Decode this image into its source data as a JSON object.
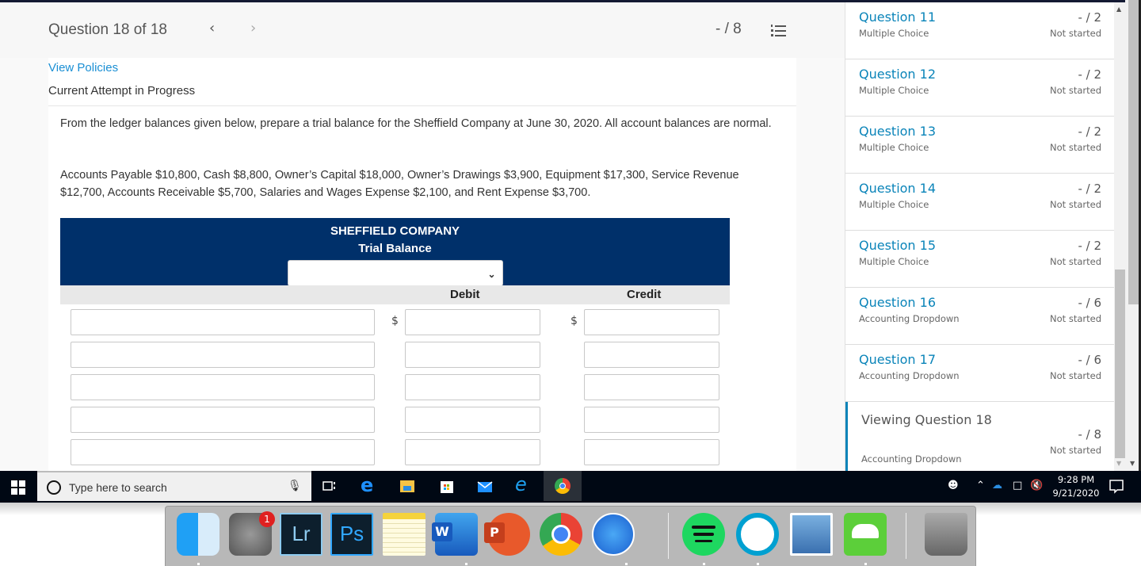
{
  "header": {
    "question_title": "Question 18 of 18",
    "prev_icon": "chevron-left-icon",
    "next_icon": "chevron-right-icon",
    "score": "- / 8",
    "list_icon": "numbered-list-icon"
  },
  "content": {
    "view_policies": "View Policies",
    "attempt_status": "Current Attempt in Progress",
    "instructions": "From the ledger balances given below, prepare a trial balance for the Sheffield Company at June 30, 2020. All account balances are normal.",
    "ledger_balances": "Accounts Payable $10,800, Cash $8,800, Owner’s Capital $18,000, Owner’s Drawings $3,900, Equipment $17,300, Service Revenue $12,700, Accounts Receivable $5,700, Salaries and Wages Expense $2,100, and Rent Expense $3,700."
  },
  "trial_balance": {
    "company": "SHEFFIELD COMPANY",
    "title": "Trial Balance",
    "date_select_value": "",
    "debit_label": "Debit",
    "credit_label": "Credit",
    "currency_symbol": "$",
    "rows": [
      {
        "account": "",
        "debit": "",
        "credit": ""
      },
      {
        "account": "",
        "debit": "",
        "credit": ""
      },
      {
        "account": "",
        "debit": "",
        "credit": ""
      },
      {
        "account": "",
        "debit": "",
        "credit": ""
      },
      {
        "account": "",
        "debit": "",
        "credit": ""
      }
    ]
  },
  "sidebar": {
    "questions": [
      {
        "name": "Question 11",
        "type": "Multiple Choice",
        "points": "- / 2",
        "status": "Not started"
      },
      {
        "name": "Question 12",
        "type": "Multiple Choice",
        "points": "- / 2",
        "status": "Not started"
      },
      {
        "name": "Question 13",
        "type": "Multiple Choice",
        "points": "- / 2",
        "status": "Not started"
      },
      {
        "name": "Question 14",
        "type": "Multiple Choice",
        "points": "- / 2",
        "status": "Not started"
      },
      {
        "name": "Question 15",
        "type": "Multiple Choice",
        "points": "- / 2",
        "status": "Not started"
      },
      {
        "name": "Question 16",
        "type": "Accounting Dropdown",
        "points": "- / 6",
        "status": "Not started"
      },
      {
        "name": "Question 17",
        "type": "Accounting Dropdown",
        "points": "- / 6",
        "status": "Not started"
      }
    ],
    "current": {
      "name": "Viewing Question 18",
      "type": "Accounting Dropdown",
      "points": "- / 8",
      "status": "Not started"
    }
  },
  "taskbar": {
    "search_placeholder": "Type here to search",
    "time": "9:28 PM",
    "date": "9/21/2020",
    "pinned": [
      "task-view",
      "edge",
      "file-explorer",
      "store",
      "mail",
      "internet-explorer",
      "chrome"
    ]
  },
  "dock": {
    "apps": [
      "Finder",
      "System Preferences",
      "Lightroom",
      "Photoshop",
      "Notes",
      "Word",
      "PowerPoint",
      "Chrome",
      "Safari",
      "Spotify",
      "Webex",
      "Preview",
      "Cloud Desktop",
      "Trash"
    ],
    "system_prefs_badge": "1",
    "lr_label": "Lr",
    "ps_label": "Ps",
    "word_label": "W",
    "ppt_label": "P"
  }
}
